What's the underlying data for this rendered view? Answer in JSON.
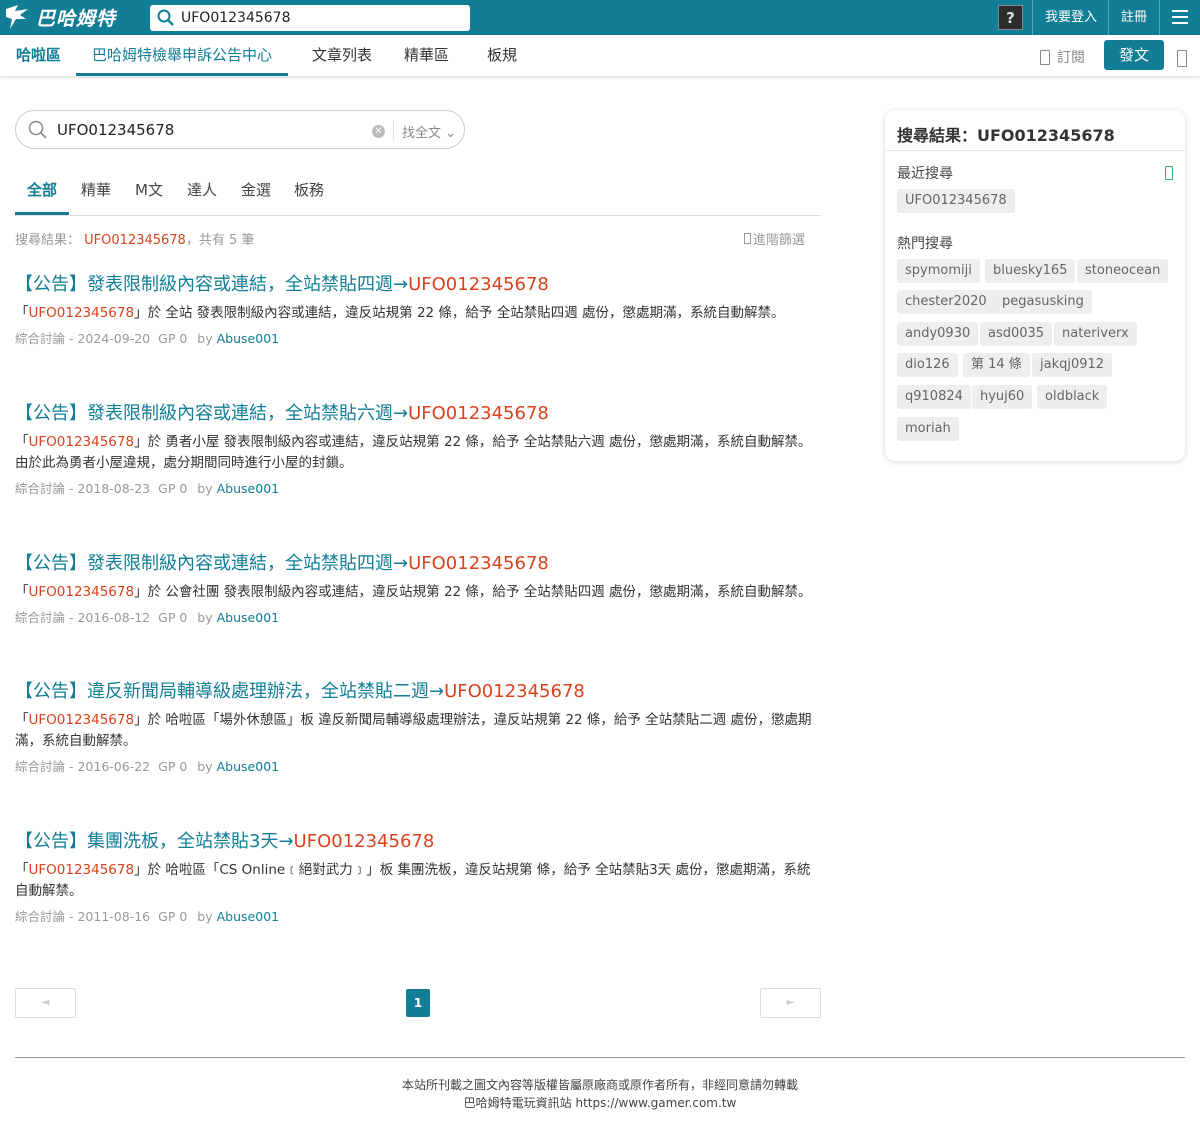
{
  "topbar": {
    "logo_text": "巴哈姆特",
    "search_value": "UFO012345678",
    "login": "我要登入",
    "register": "註冊"
  },
  "boardnav": {
    "home": "哈啦區",
    "items": [
      "巴哈姆特檢舉申訴公告中心",
      "文章列表",
      "精華區",
      "板規"
    ],
    "subscribe": "訂閱",
    "post": "發文"
  },
  "search": {
    "value": "UFO012345678",
    "scope": "找全文",
    "tabs": [
      "全部",
      "精華",
      "M文",
      "達人",
      "金選",
      "板務"
    ],
    "summary_prefix": "搜尋結果：",
    "summary_keyword": "UFO012345678",
    "summary_count": "，共有 5 筆",
    "advanced": "進階篩選"
  },
  "results": [
    {
      "title": "【公告】發表限制級內容或連結，全站禁貼四週→",
      "title_kw": "UFO012345678",
      "desc_open": "「",
      "desc_kw": "UFO012345678",
      "desc": "」於 全站 發表限制級內容或連結，違反站規第 22 條，給予 全站禁貼四週 處份，懲處期滿，系統自動解禁。",
      "category": "綜合討論",
      "date": "- 2024-09-20",
      "gp": "GP 0",
      "by": "by",
      "author": "Abuse001"
    },
    {
      "title": "【公告】發表限制級內容或連結，全站禁貼六週→",
      "title_kw": "UFO012345678",
      "desc_open": "「",
      "desc_kw": "UFO012345678",
      "desc": "」於 勇者小屋 發表限制級內容或連結，違反站規第 22 條，給予 全站禁貼六週 處份，懲處期滿，系統自動解禁。由於此為勇者小屋違規，處分期間同時進行小屋的封鎖。",
      "category": "綜合討論",
      "date": "- 2018-08-23",
      "gp": "GP 0",
      "by": "by",
      "author": "Abuse001"
    },
    {
      "title": "【公告】發表限制級內容或連結，全站禁貼四週→",
      "title_kw": "UFO012345678",
      "desc_open": "「",
      "desc_kw": "UFO012345678",
      "desc": "」於 公會社團 發表限制級內容或連結，違反站規第 22 條，給予 全站禁貼四週 處份，懲處期滿，系統自動解禁。",
      "category": "綜合討論",
      "date": "- 2016-08-12",
      "gp": "GP 0",
      "by": "by",
      "author": "Abuse001"
    },
    {
      "title": "【公告】違反新聞局輔導級處理辦法，全站禁貼二週→",
      "title_kw": "UFO012345678",
      "desc_open": "「",
      "desc_kw": "UFO012345678",
      "desc": "」於 哈啦區「場外休憩區」板 違反新聞局輔導級處理辦法，違反站規第 22 條，給予 全站禁貼二週 處份，懲處期滿，系統自動解禁。",
      "category": "綜合討論",
      "date": "- 2016-06-22",
      "gp": "GP 0",
      "by": "by",
      "author": "Abuse001"
    },
    {
      "title": "【公告】集團洗板，全站禁貼3天→",
      "title_kw": "UFO012345678",
      "desc_open": "「",
      "desc_kw": "UFO012345678",
      "desc": "」於 哈啦區「CS Online﹝絕對武力﹞」板 集團洗板，違反站規第 條，給予 全站禁貼3天 處份，懲處期滿，系統自動解禁。",
      "category": "綜合討論",
      "date": "- 2011-08-16",
      "gp": "GP 0",
      "by": "by",
      "author": "Abuse001"
    }
  ],
  "pager": {
    "prev": "◄",
    "page": "1",
    "next": "►"
  },
  "footer": {
    "line1": "本站所刊載之圖文內容等版權皆屬原廠商或原作者所有，非經同意請勿轉載",
    "line2": "巴哈姆特電玩資訊站 https://www.gamer.com.tw"
  },
  "sidebar": {
    "title": "搜尋結果：UFO012345678",
    "recent_label": "最近搜尋",
    "recent": [
      "UFO012345678"
    ],
    "hot_label": "熱門搜尋",
    "hot": [
      "spymomiji",
      "bluesky165",
      "stoneocean",
      "chester2020",
      "pegasusking",
      "andy0930",
      "asd0035",
      "nateriverx",
      "dio126",
      "第 14 條",
      "jakqj0912",
      "q910824",
      "hyuj60",
      "oldblack",
      "moriah"
    ]
  },
  "colors": {
    "brand": "#117e96",
    "keyword": "#d9421c"
  },
  "icons": [
    "bahamut-logo-icon",
    "search-icon",
    "avatar-icon",
    "hamburger-menu-icon",
    "subscribe-icon",
    "more-icon",
    "clear-icon",
    "chevron-down-icon",
    "filter-icon",
    "trash-icon"
  ]
}
